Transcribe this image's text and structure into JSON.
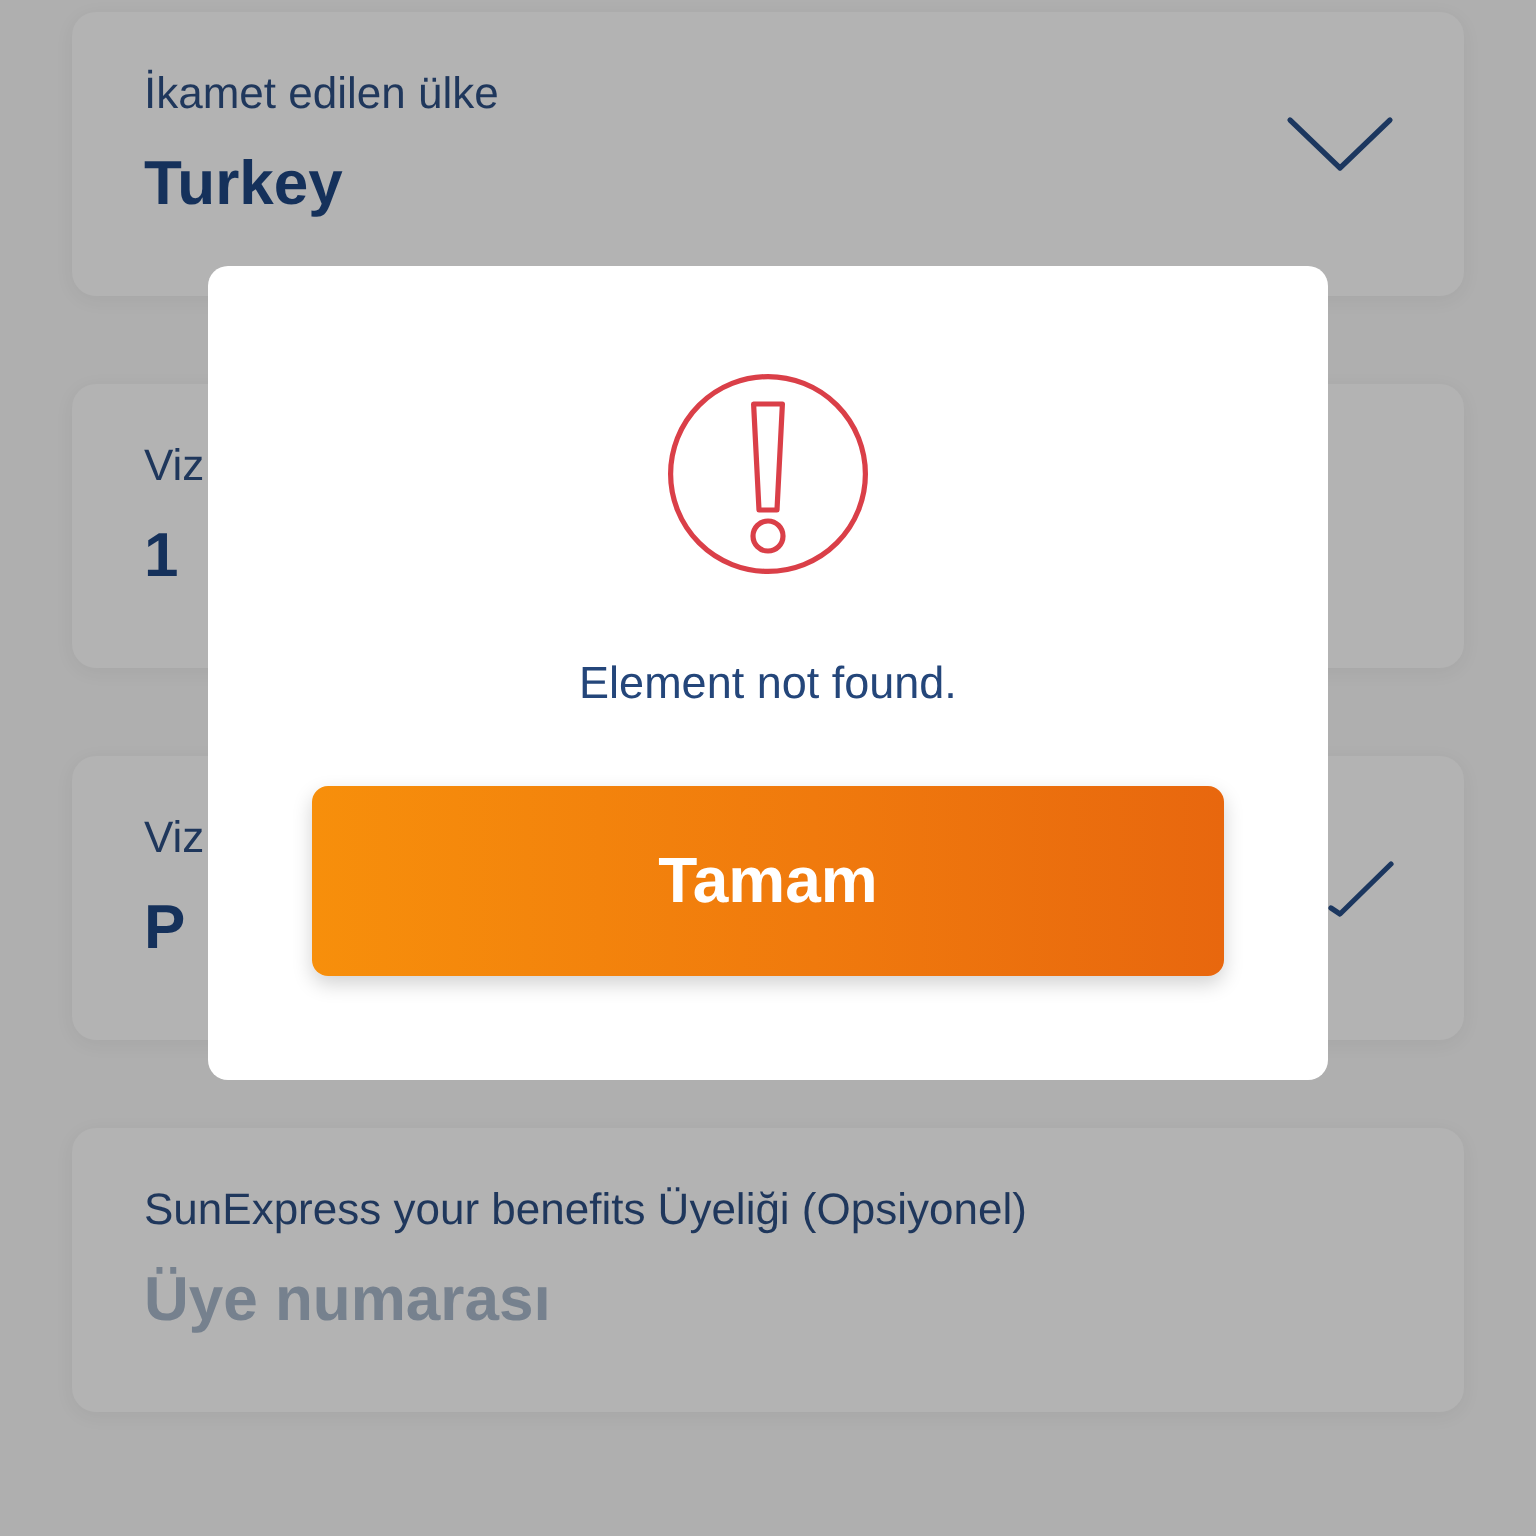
{
  "form": {
    "fields": [
      {
        "kind": "select",
        "label": "İkamet edilen ülke",
        "value": "Turkey"
      },
      {
        "kind": "plain",
        "label": "Viz",
        "value": "1"
      },
      {
        "kind": "partial",
        "label": "Viz",
        "value": "P"
      },
      {
        "kind": "input",
        "label": "SunExpress your benefits Üyeliği (Opsiyonel)",
        "placeholder": "Üye numarası"
      }
    ]
  },
  "dialog": {
    "message": "Element not found.",
    "button": "Tamam"
  }
}
